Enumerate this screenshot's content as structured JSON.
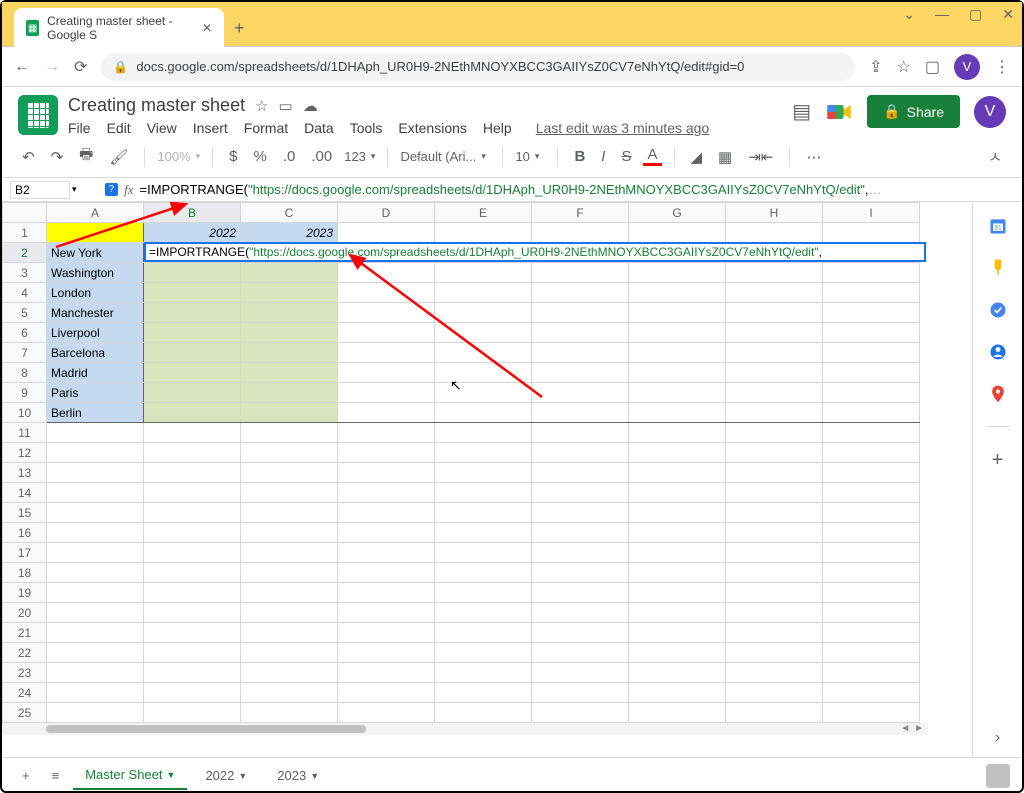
{
  "browser": {
    "tab_title": "Creating master sheet - Google S",
    "url": "docs.google.com/spreadsheets/d/1DHAph_UR0H9-2NEthMNOYXBCC3GAIIYsZ0CV7eNhYtQ/edit#gid=0",
    "avatar_letter": "V"
  },
  "doc": {
    "title": "Creating master sheet",
    "last_edit": "Last edit was 3 minutes ago",
    "share": "Share"
  },
  "menu": [
    "File",
    "Edit",
    "View",
    "Insert",
    "Format",
    "Data",
    "Tools",
    "Extensions",
    "Help"
  ],
  "toolbar": {
    "zoom": "100%",
    "num_fmt": "123",
    "font": "Default (Ari...",
    "size": "10"
  },
  "formula_bar": {
    "cell": "B2",
    "prefix": "=IMPORTRANGE(",
    "url": "\"https://docs.google.com/spreadsheets/d/1DHAph_UR0H9-2NEthMNOYXBCC3GAIIYsZ0CV7eNhYtQ/edit\"",
    "suffix": ","
  },
  "cell_overlay": {
    "prefix": "=IMPORTRANGE(",
    "url": "\"https://docs.google.com/spreadsheets/d/1DHAph_UR0H9-2NEthMNOYXBCC3GAIIYsZ0CV7eNhYtQ/edit\"",
    "suffix": ","
  },
  "columns": [
    "A",
    "B",
    "C",
    "D",
    "E",
    "F",
    "G",
    "H",
    "I"
  ],
  "header_row": {
    "b": "2022",
    "c": "2023"
  },
  "rows": [
    {
      "n": "1",
      "a": ""
    },
    {
      "n": "2",
      "a": "New York"
    },
    {
      "n": "3",
      "a": "Washington"
    },
    {
      "n": "4",
      "a": "London"
    },
    {
      "n": "5",
      "a": "Manchester"
    },
    {
      "n": "6",
      "a": "Liverpool"
    },
    {
      "n": "7",
      "a": "Barcelona"
    },
    {
      "n": "8",
      "a": "Madrid"
    },
    {
      "n": "9",
      "a": "Paris"
    },
    {
      "n": "10",
      "a": "Berlin"
    },
    {
      "n": "11",
      "a": ""
    },
    {
      "n": "12",
      "a": ""
    },
    {
      "n": "13",
      "a": ""
    },
    {
      "n": "14",
      "a": ""
    },
    {
      "n": "15",
      "a": ""
    },
    {
      "n": "16",
      "a": ""
    },
    {
      "n": "17",
      "a": ""
    },
    {
      "n": "18",
      "a": ""
    },
    {
      "n": "19",
      "a": ""
    },
    {
      "n": "20",
      "a": ""
    },
    {
      "n": "21",
      "a": ""
    },
    {
      "n": "22",
      "a": ""
    },
    {
      "n": "23",
      "a": ""
    },
    {
      "n": "24",
      "a": ""
    },
    {
      "n": "25",
      "a": ""
    }
  ],
  "sheet_tabs": {
    "active": "Master Sheet",
    "others": [
      "2022",
      "2023"
    ]
  }
}
